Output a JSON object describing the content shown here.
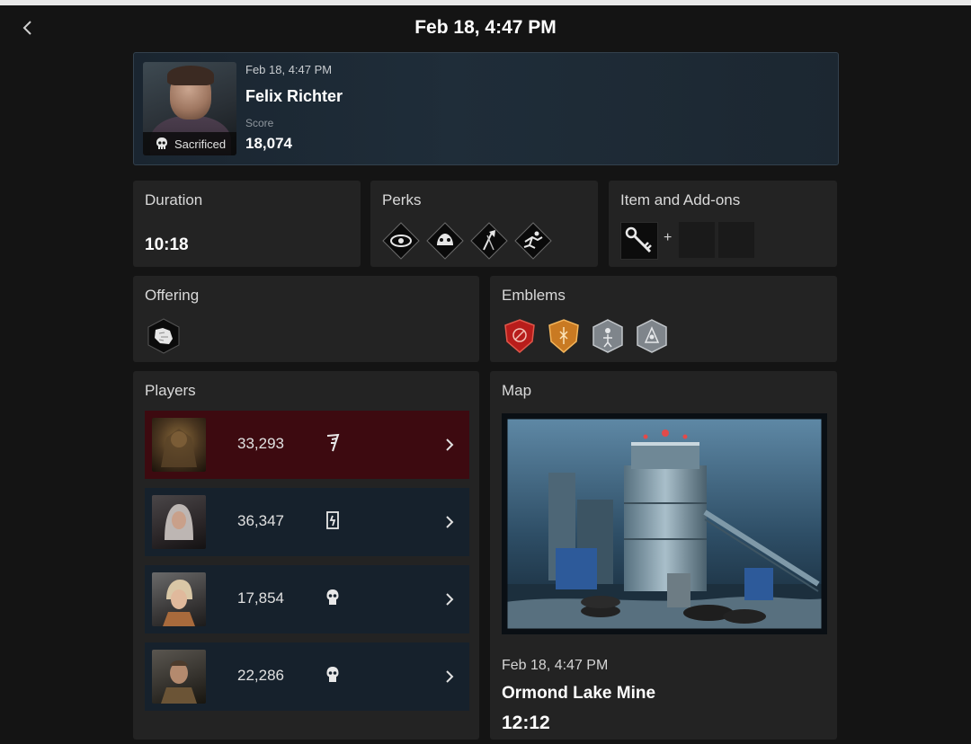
{
  "header": {
    "title": "Feb 18, 4:47 PM"
  },
  "summary": {
    "date": "Feb 18, 4:47 PM",
    "name": "Felix Richter",
    "score_label": "Score",
    "score": "18,074",
    "status": "Sacrificed",
    "status_icon": "skull-icon"
  },
  "duration": {
    "title": "Duration",
    "value": "10:18"
  },
  "perks": {
    "title": "Perks",
    "icons": [
      "eye-perk-icon",
      "hands-perk-icon",
      "axe-perk-icon",
      "runner-perk-icon"
    ]
  },
  "items": {
    "title": "Item and Add-ons",
    "item_icon": "key-icon",
    "plus": "+"
  },
  "offering": {
    "title": "Offering",
    "icon": "map-offering-icon"
  },
  "emblems": {
    "title": "Emblems",
    "list": [
      {
        "name": "red-emblem-icon",
        "color": "#c4231f"
      },
      {
        "name": "gold-emblem-icon",
        "color": "#d9862a"
      },
      {
        "name": "silver-emblem-icon",
        "color": "#8a8f95"
      },
      {
        "name": "silver-emblem-icon",
        "color": "#8a8f95"
      }
    ]
  },
  "players": {
    "title": "Players",
    "rows": [
      {
        "role": "killer",
        "score": "33,293",
        "status_icon": "killer-claw-icon"
      },
      {
        "role": "survivor",
        "score": "36,347",
        "status_icon": "escaped-door-icon"
      },
      {
        "role": "survivor",
        "score": "17,854",
        "status_icon": "skull-icon"
      },
      {
        "role": "survivor",
        "score": "22,286",
        "status_icon": "skull-icon"
      }
    ]
  },
  "map": {
    "title": "Map",
    "date": "Feb 18, 4:47 PM",
    "name": "Ormond Lake Mine",
    "time": "12:12"
  }
}
